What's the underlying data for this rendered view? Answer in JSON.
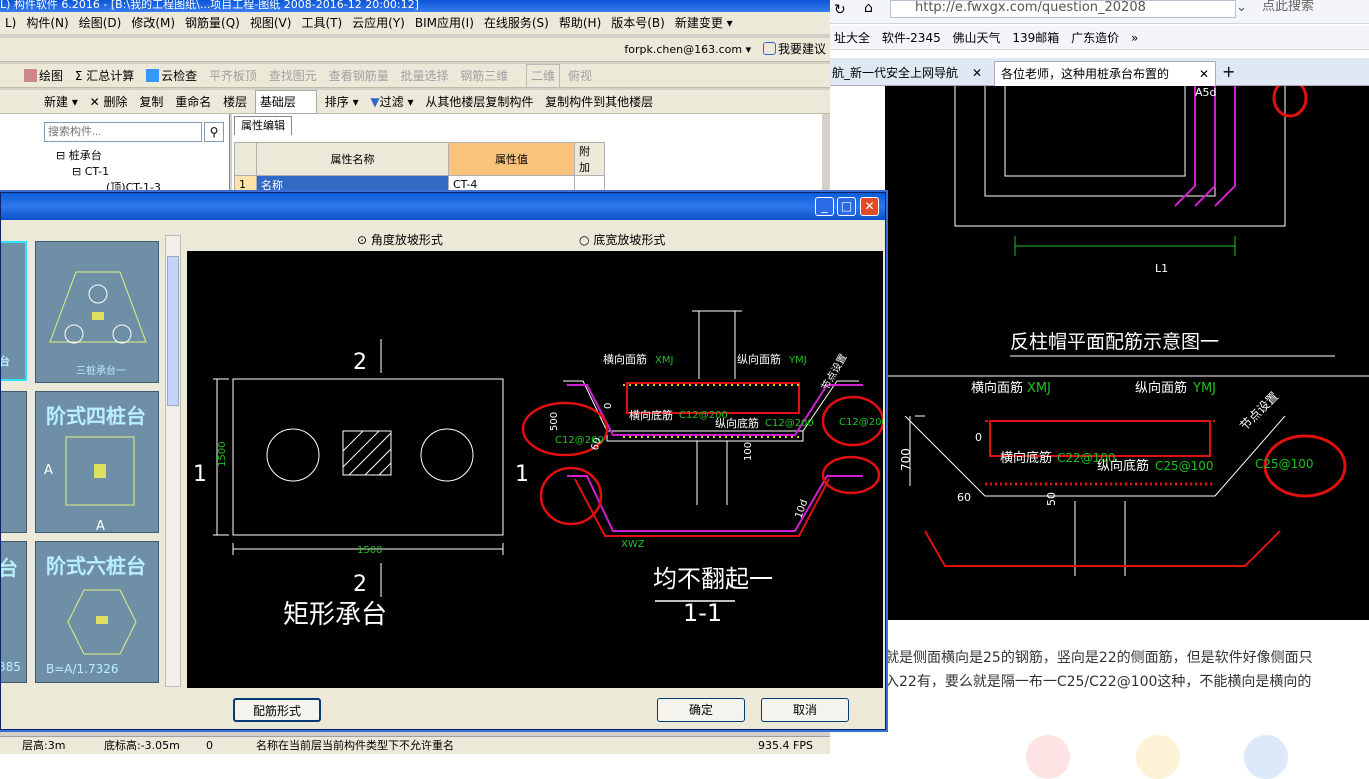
{
  "app": {
    "title": "L) 构件软件 6.2016 - [B:\\我的工程图纸\\...项目工程-图纸 2008-2016-12 20:00:12]",
    "menus": [
      "L)",
      "构件(N)",
      "绘图(D)",
      "修改(M)",
      "钢筋量(Q)",
      "视图(V)",
      "工具(T)",
      "云应用(Y)",
      "BIM应用(I)",
      "在线服务(S)",
      "帮助(H)",
      "版本号(B)",
      "新建变更 ▾"
    ],
    "account": "forpk.chen@163.com ▾",
    "suggest": "我要建议",
    "toolbar1": [
      "绘图",
      "Σ 汇总计算",
      "云检查",
      "平齐板顶",
      "查找图元",
      "查看钢筋量",
      "批量选择",
      "钢筋三维",
      "二维",
      "俯视"
    ],
    "toolbar2": [
      "新建 ▾",
      "删除",
      "复制",
      "重命名",
      "楼层",
      "基础层",
      "排序 ▾",
      "过滤 ▾",
      "从其他楼层复制构件",
      "复制构件到其他楼层"
    ],
    "search_placeholder": "搜索构件...",
    "tree": [
      "桩承台",
      "CT-1",
      "(顶)CT-1-3"
    ],
    "prop_tab": "属性编辑",
    "prop_headers": [
      "属性名称",
      "属性值",
      "附加"
    ],
    "prop_row": {
      "num": "1",
      "name": "名称",
      "value": "CT-4"
    },
    "status": {
      "floor": "层高:3m",
      "bottom": "底标高:-3.05m",
      "num": "0",
      "msg": "名称在当前层当前构件类型下不允许重名",
      "fps": "935.4 FPS"
    }
  },
  "dialog": {
    "radio1": "角度放坡形式",
    "radio2": "底宽放坡形式",
    "thumbs": [
      "三桩承台一",
      "阶式四桩台",
      "阶式六桩台",
      "台",
      "385",
      "B=A/1.7326"
    ],
    "btn_rebar": "配筋形式",
    "btn_ok": "确定",
    "btn_cancel": "取消",
    "drawing": {
      "plan_title": "矩形承台",
      "section_title": "1-1",
      "note": "均不翻起一",
      "dim_w": "1500",
      "dim_h": "1500",
      "sec_num": "2",
      "sec_side": "1",
      "labels": {
        "top_h": "横向面筋",
        "top_h_code": "XMJ",
        "top_v": "纵向面筋",
        "top_v_code": "YMJ",
        "bot_h": "横向底筋",
        "bot_h_val": "C12@200",
        "bot_v": "纵向底筋",
        "bot_v_val": "C12@200",
        "side": "C12@200",
        "side2": "C12@200",
        "corner": "节点设置",
        "xwz": "XWZ",
        "h500": "500",
        "zero": "0",
        "h100": "100",
        "d10": "10d",
        "ang": "60"
      }
    }
  },
  "browser": {
    "url": "http://e.fwxgx.com/question_20208",
    "search": "点此搜索",
    "bookmarks": [
      "址大全",
      "软件-2345",
      "佛山天气",
      "139邮箱",
      "广东造价",
      "»"
    ],
    "tabs": [
      "航_新一代安全上网导航",
      "各位老师，这种用桩承台布置的"
    ],
    "web_drawing": {
      "title": "反柱帽平面配筋示意图一",
      "a5d": "A5d",
      "l1": "L1",
      "top_h": "横向面筋",
      "top_h_code": "XMJ",
      "top_v": "纵向面筋",
      "top_v_code": "YMJ",
      "bot_h": "横向底筋",
      "bot_h_val": "C22@100",
      "bot_v": "纵向底筋",
      "bot_v_val": "C25@100",
      "side": "C25@100",
      "corner": "节点设置",
      "h700": "700",
      "zero": "0",
      "h50": "50",
      "ang": "60"
    },
    "text_lines": [
      "就是侧面横向是25的钢筋，竖向是22的侧面筋，但是软件好像侧面只",
      "入22有，要么就是隔一布一C25/C22@100这种，不能横向是横向的"
    ]
  },
  "colors": {
    "accent": "#0a55d6",
    "canvas": "#000000",
    "red": "#e01010",
    "green": "#20c020",
    "magenta": "#d020d0",
    "thumb": "#6f8fa6"
  }
}
